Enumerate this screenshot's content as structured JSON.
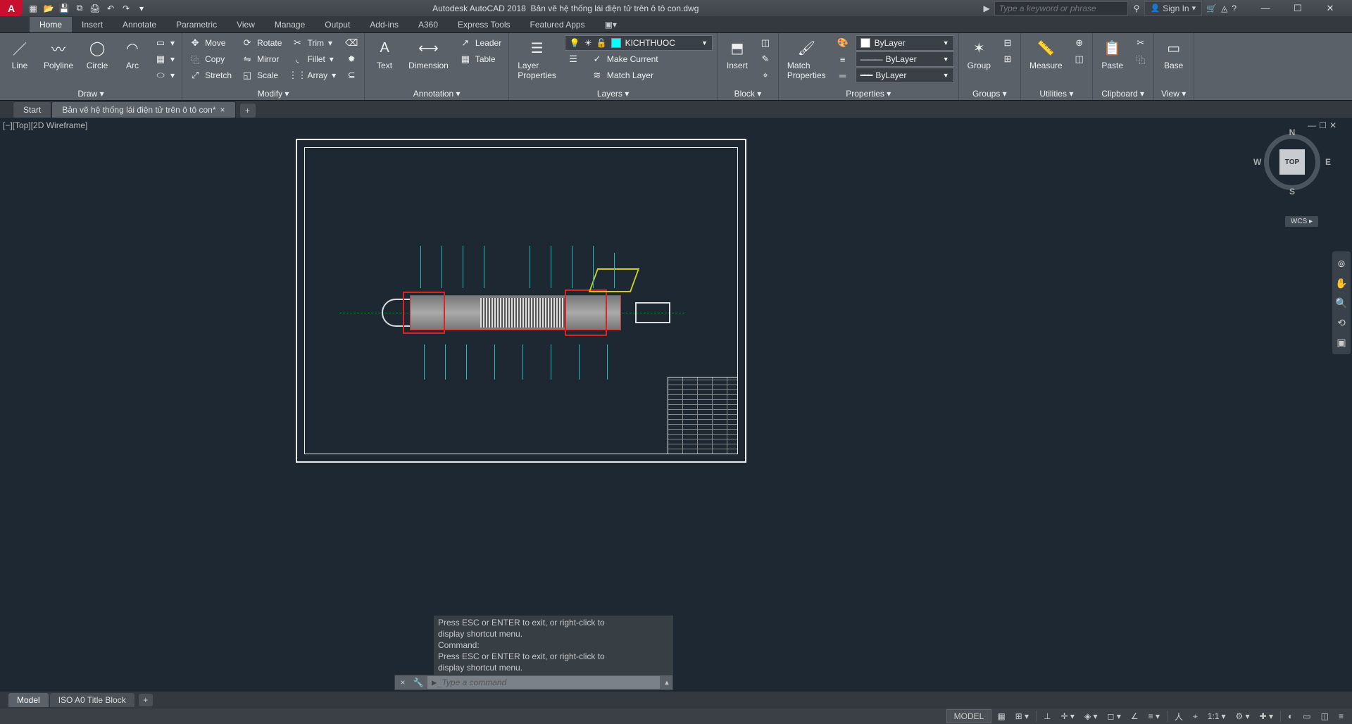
{
  "app": {
    "name": "Autodesk AutoCAD 2018",
    "document": "Bản vẽ hệ thống lái điện tử trên ô tô con.dwg",
    "search_placeholder": "Type a keyword or phrase",
    "sign_in": "Sign In"
  },
  "ribbon_tabs": [
    "Home",
    "Insert",
    "Annotate",
    "Parametric",
    "View",
    "Manage",
    "Output",
    "Add-ins",
    "A360",
    "Express Tools",
    "Featured Apps"
  ],
  "active_tab": "Home",
  "panels": {
    "draw": {
      "label": "Draw ▾",
      "items": [
        "Line",
        "Polyline",
        "Circle",
        "Arc"
      ]
    },
    "modify": {
      "label": "Modify ▾",
      "row1": [
        "Move",
        "Rotate",
        "Trim"
      ],
      "row2": [
        "Copy",
        "Mirror",
        "Fillet"
      ],
      "row3": [
        "Stretch",
        "Scale",
        "Array"
      ]
    },
    "annotation": {
      "label": "Annotation ▾",
      "big": [
        "Text",
        "Dimension"
      ],
      "small": [
        "Leader",
        "Table"
      ]
    },
    "layers": {
      "label": "Layers ▾",
      "big": "Layer\nProperties",
      "current": "KICHTHUOC",
      "items": [
        "Make Current",
        "Match Layer"
      ]
    },
    "block": {
      "label": "Block ▾",
      "big": "Insert"
    },
    "properties": {
      "label": "Properties ▾",
      "big": "Match\nProperties",
      "color": "ByLayer",
      "line": "ByLayer",
      "lw": "ByLayer"
    },
    "groups": {
      "label": "Groups ▾",
      "big": "Group"
    },
    "utilities": {
      "label": "Utilities ▾",
      "big": "Measure"
    },
    "clipboard": {
      "label": "Clipboard ▾",
      "big": "Paste"
    },
    "view": {
      "label": "View ▾",
      "big": "Base"
    }
  },
  "file_tabs": {
    "start": "Start",
    "doc": "Bản vẽ hệ thống lái điện tử trên ô tô con*"
  },
  "viewport": {
    "label": "[−][Top][2D Wireframe]",
    "cube_face": "TOP",
    "wcs": "WCS ▸",
    "dirs": {
      "n": "N",
      "s": "S",
      "e": "E",
      "w": "W"
    }
  },
  "command": {
    "history": [
      "Press ESC or ENTER to exit, or right-click to",
      "display shortcut menu.",
      "Command:",
      "Press ESC or ENTER to exit, or right-click to",
      "display shortcut menu."
    ],
    "prompt": "Type a command"
  },
  "layout_tabs": [
    "Model",
    "ISO A0 Title Block"
  ],
  "status": {
    "model": "MODEL",
    "scale": "1:1"
  }
}
